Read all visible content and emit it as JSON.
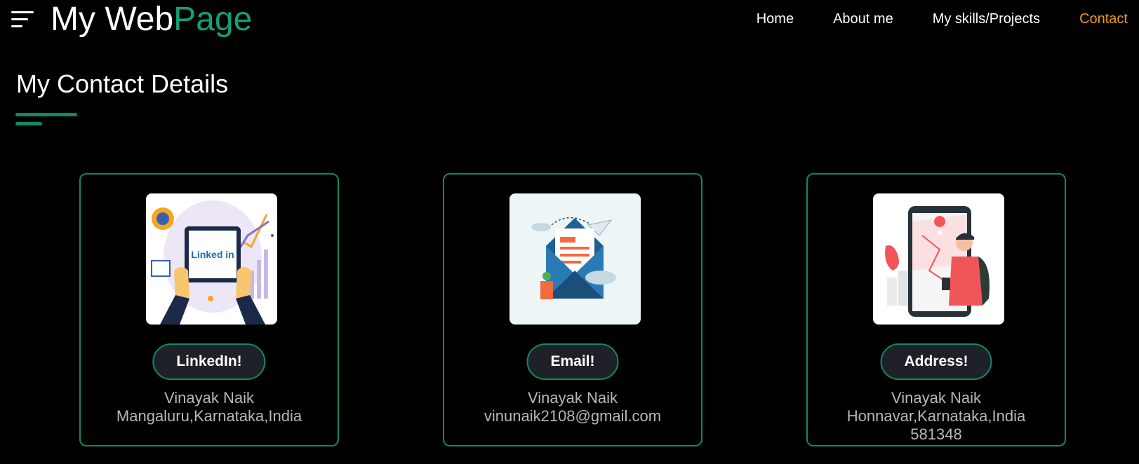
{
  "header": {
    "menu_icon": "hamburger-menu-icon",
    "brand_part1": "My Web",
    "brand_part2": "Page",
    "nav": [
      {
        "label": "Home"
      },
      {
        "label": "About me"
      },
      {
        "label": "My skills/Projects"
      },
      {
        "label": "Contact",
        "active": true
      }
    ]
  },
  "section": {
    "title": "My Contact Details"
  },
  "cards": [
    {
      "image": "linkedin-illustration",
      "button": "LinkedIn!",
      "lines": [
        "Vinayak Naik",
        "Mangaluru,Karnataka,India"
      ],
      "image_text": "Linked in"
    },
    {
      "image": "email-envelope-illustration",
      "button": "Email!",
      "lines": [
        "Vinayak Naik",
        "vinunaik2108@gmail.com"
      ]
    },
    {
      "image": "location-map-phone-illustration",
      "button": "Address!",
      "lines": [
        "Vinayak Naik",
        "Honnavar,Karnataka,India",
        "581348"
      ]
    }
  ],
  "colors": {
    "background": "#000000",
    "accent_green": "#0f8a64",
    "brand_green": "#14a077",
    "active_nav": "#f29b12",
    "button_bg": "#1e2228",
    "card_text": "#b8b8b8"
  }
}
